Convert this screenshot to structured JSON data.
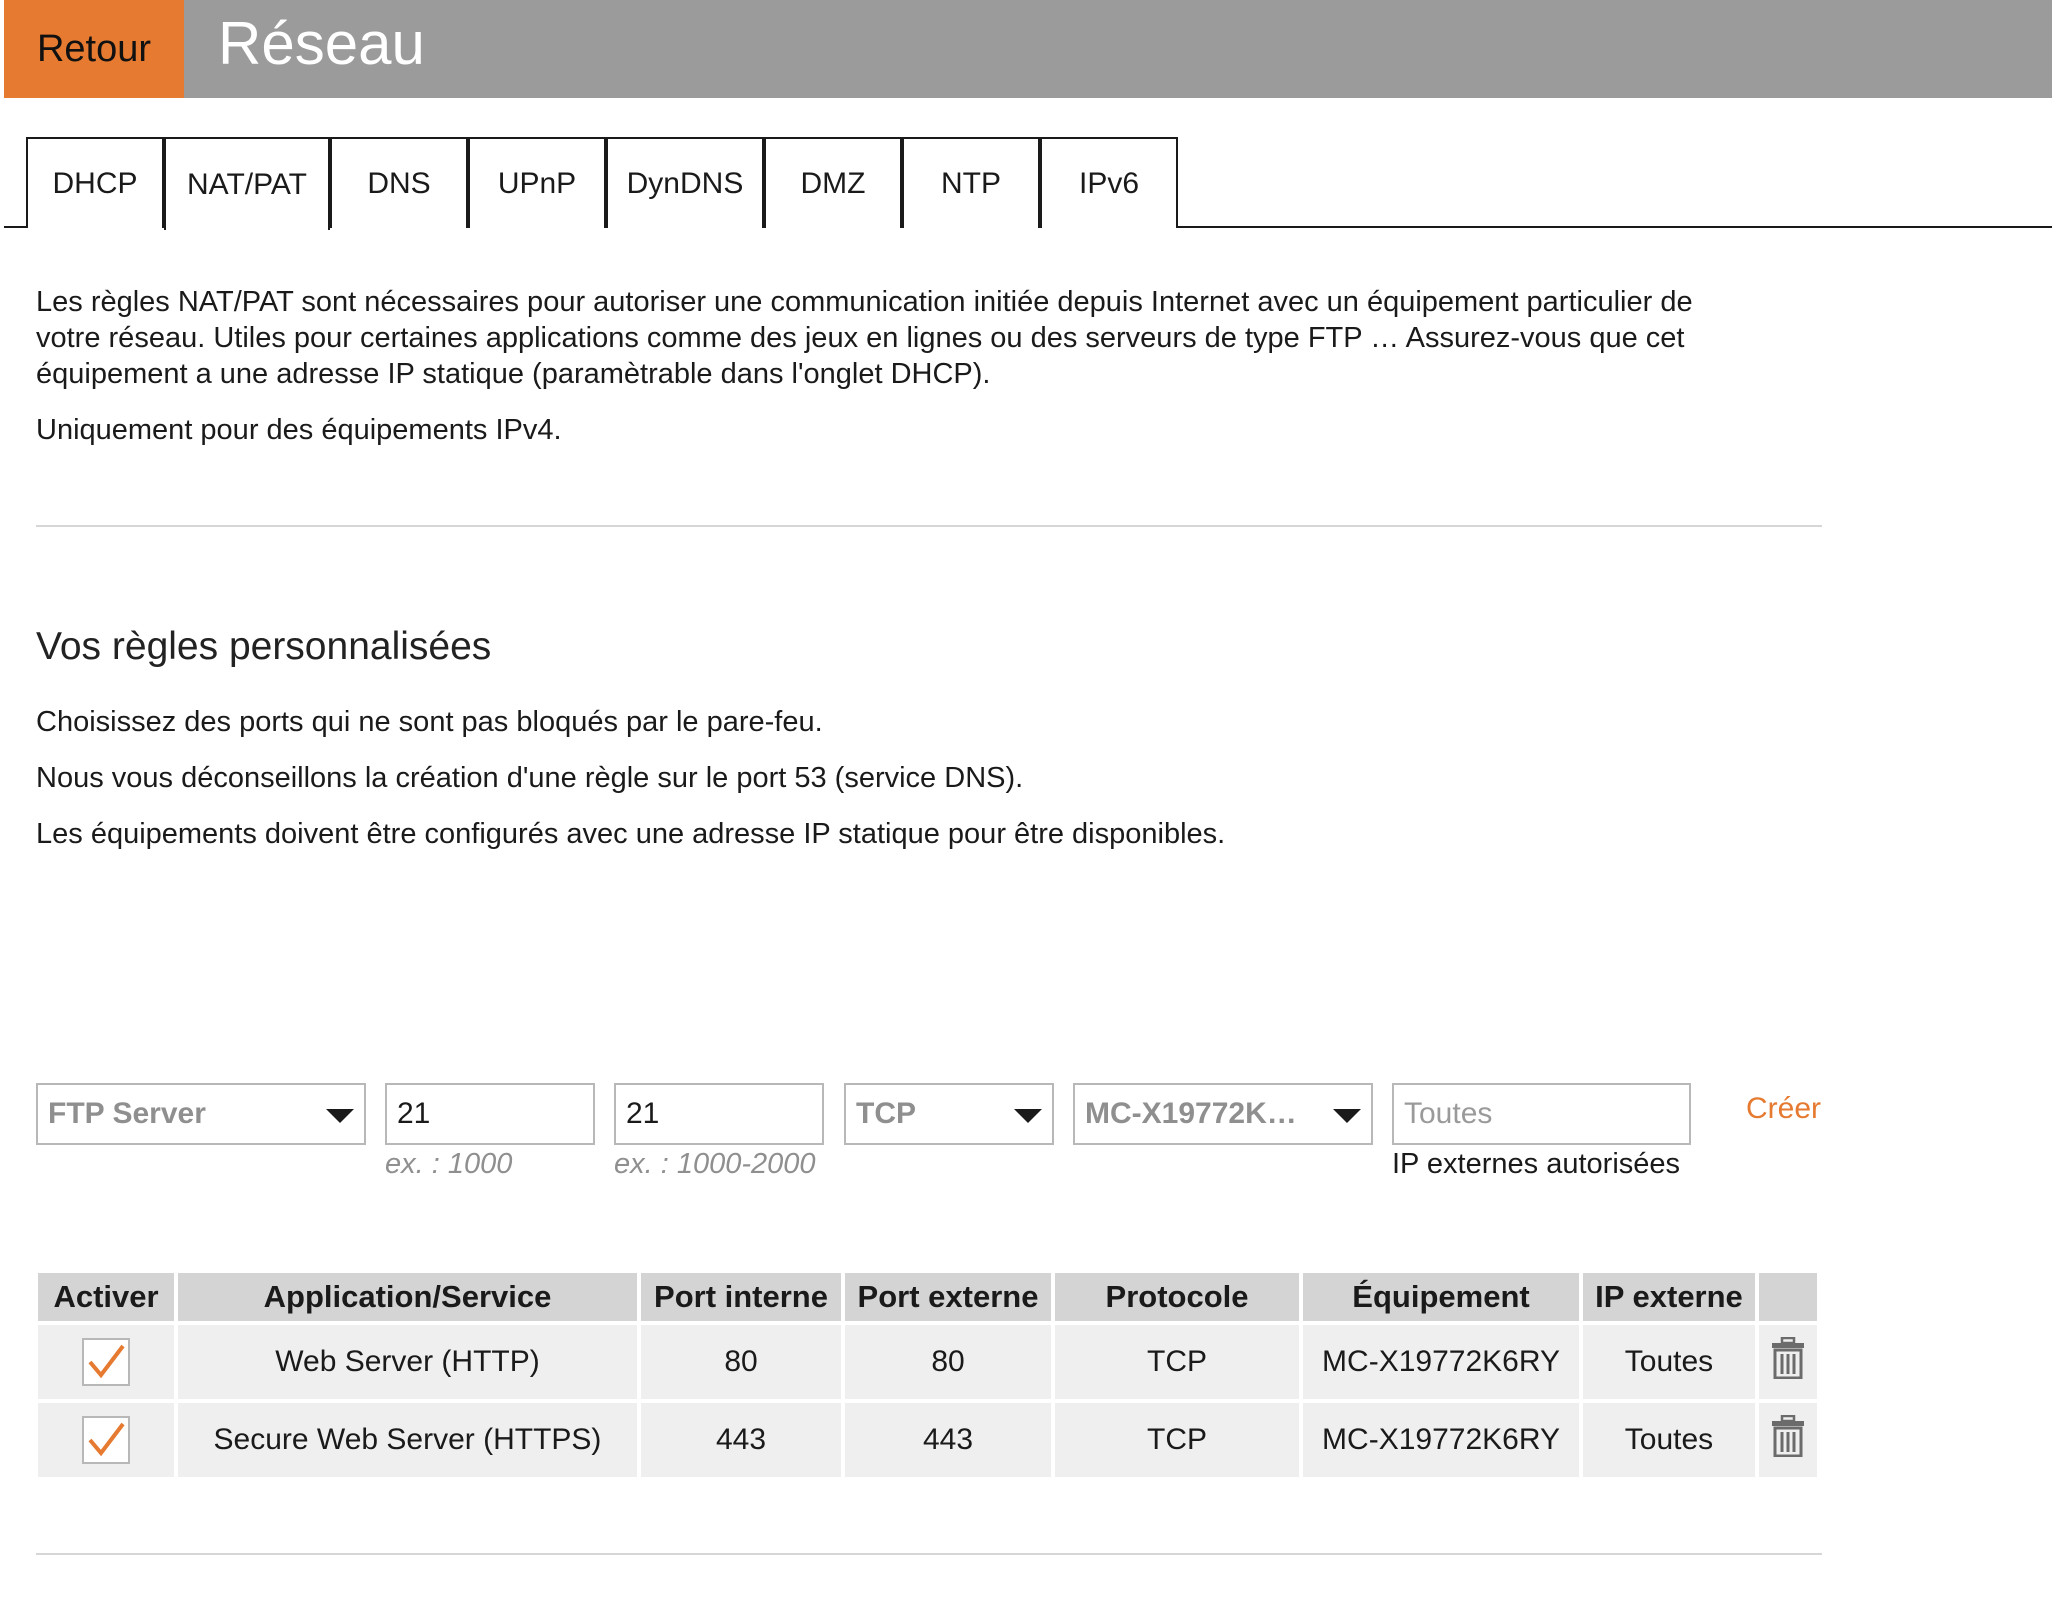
{
  "header": {
    "back_label": "Retour",
    "title": "Réseau"
  },
  "tabs": [
    {
      "label": "DHCP",
      "active": false
    },
    {
      "label": "NAT/PAT",
      "active": true
    },
    {
      "label": "DNS",
      "active": false
    },
    {
      "label": "UPnP",
      "active": false
    },
    {
      "label": "DynDNS",
      "active": false
    },
    {
      "label": "DMZ",
      "active": false
    },
    {
      "label": "NTP",
      "active": false
    },
    {
      "label": "IPv6",
      "active": false
    }
  ],
  "intro": {
    "line1": "Les règles NAT/PAT sont nécessaires pour autoriser une communication initiée depuis Internet avec un équipement particulier de",
    "line2": "votre réseau. Utiles pour certaines applications comme des jeux en lignes ou des serveurs de type FTP … Assurez-vous que cet",
    "line3": "équipement a une adresse IP statique (paramètrable dans l'onglet DHCP).",
    "ipv4_note": "Uniquement pour des équipements IPv4."
  },
  "custom_rules": {
    "title": "Vos règles personnalisées",
    "note1": "Choisissez des ports qui ne sont pas bloqués par le pare-feu.",
    "note2": "Nous vous déconseillons la création d'une règle sur le port 53 (service DNS).",
    "note3": "Les équipements doivent être configurés avec une adresse IP statique pour être disponibles."
  },
  "form": {
    "service_select": "FTP Server",
    "internal_port": "21",
    "internal_port_hint": "ex. : 1000",
    "external_port": "21",
    "external_port_hint": "ex. : 1000-2000",
    "protocol_select": "TCP",
    "device_select": "MC-X19772K…",
    "allowed_ips_placeholder": "Toutes",
    "allowed_ips_label": "IP externes autorisées",
    "create_label": "Créer"
  },
  "table": {
    "headers": [
      "Activer",
      "Application/Service",
      "Port interne",
      "Port externe",
      "Protocole",
      "Équipement",
      "IP externe",
      ""
    ],
    "rows": [
      {
        "enabled": true,
        "service": "Web Server (HTTP)",
        "internal_port": "80",
        "external_port": "80",
        "protocol": "TCP",
        "device": "MC-X19772K6RY",
        "external_ip": "Toutes"
      },
      {
        "enabled": true,
        "service": "Secure Web Server (HTTPS)",
        "internal_port": "443",
        "external_port": "443",
        "protocol": "TCP",
        "device": "MC-X19772K6RY",
        "external_ip": "Toutes"
      }
    ]
  },
  "colors": {
    "accent": "#e57a30",
    "header_bg": "#9b9b9b",
    "table_header_bg": "#d4d4d4",
    "table_cell_bg": "#efefef"
  },
  "icons": {
    "checkbox_checked": "checkmark-icon",
    "delete": "trash-icon",
    "dropdown": "caret-down-icon"
  }
}
